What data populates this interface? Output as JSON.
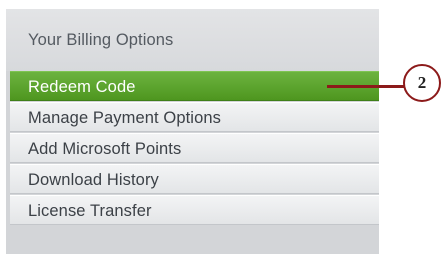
{
  "billing_menu": {
    "header": "Your Billing Options",
    "items": [
      {
        "label": "Redeem Code",
        "selected": true
      },
      {
        "label": "Manage Payment Options",
        "selected": false
      },
      {
        "label": "Add Microsoft Points",
        "selected": false
      },
      {
        "label": "Download History",
        "selected": false
      },
      {
        "label": "License Transfer",
        "selected": false
      }
    ]
  },
  "callout": {
    "number": "2",
    "color": "#8c1a1a"
  },
  "colors": {
    "selected_green": "#5aa52b",
    "header_text": "#545a61",
    "item_text": "#3c4147"
  }
}
